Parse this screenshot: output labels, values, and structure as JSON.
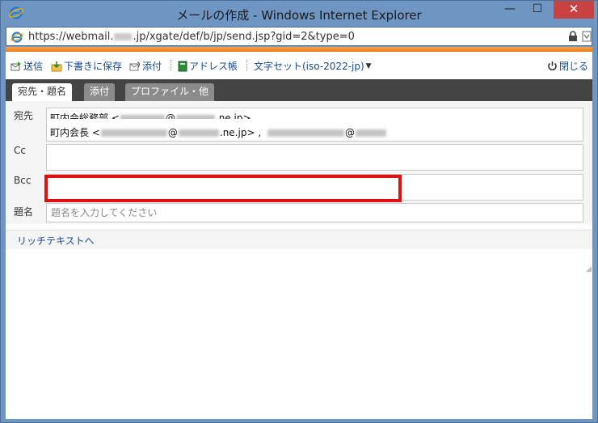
{
  "window": {
    "title": "メールの作成 - Windows Internet Explorer",
    "minimize": "—",
    "maximize": "☐",
    "close": "✕"
  },
  "address": {
    "url_prefix": "https://webmail.",
    "url_suffix": ".jp/xgate/def/b/jp/send.jsp?gid=2&type=0"
  },
  "toolbar": {
    "send": "送信",
    "save_draft": "下書きに保存",
    "attach": "添付",
    "address_book": "アドレス帳",
    "charset": "文字セット(iso-2022-jp)",
    "close": "閉じる"
  },
  "tabs": [
    {
      "label": "宛先・題名",
      "active": true
    },
    {
      "label": "添付",
      "active": false
    },
    {
      "label": "プロファイル・他",
      "active": false
    }
  ],
  "form": {
    "to_label": "宛先",
    "cc_label": "Cc",
    "bcc_label": "Bcc",
    "subject_label": "題名",
    "to_line1_name": "町内会総務部 <",
    "to_line1_at": "@",
    "to_line1_domain": ".ne.jp>",
    "to_line2_name": "町内会長 <",
    "to_line2_at": "@",
    "to_line2_domain": ".ne.jp> ,",
    "to_line2_at2": "@",
    "subject_placeholder": "題名を入力してください"
  },
  "richtext_link": "リッチテキストへ",
  "colors": {
    "accent_orange": "#ec7a18",
    "highlight_red": "#e01010",
    "link_blue": "#1a4a8a",
    "tab_bar": "#444444"
  }
}
